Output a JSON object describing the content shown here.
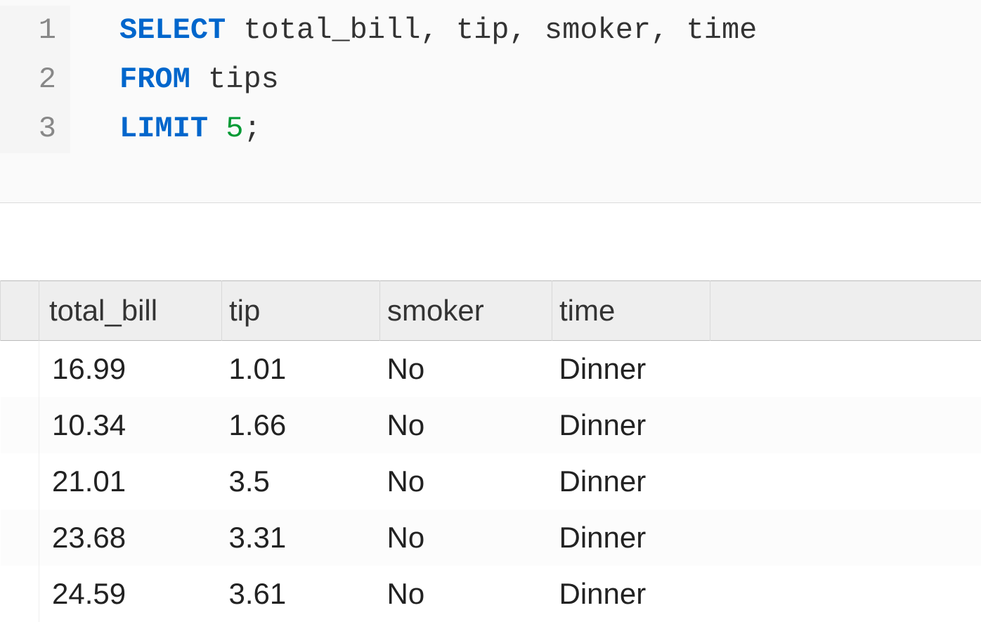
{
  "editor": {
    "line_numbers": [
      "1",
      "2",
      "3"
    ],
    "tokens": [
      [
        {
          "t": "SELECT",
          "c": "kw"
        },
        {
          "t": " total_bill, tip, smoker, time",
          "c": ""
        }
      ],
      [
        {
          "t": "FROM",
          "c": "kw"
        },
        {
          "t": " tips",
          "c": ""
        }
      ],
      [
        {
          "t": "LIMIT",
          "c": "kw"
        },
        {
          "t": " ",
          "c": ""
        },
        {
          "t": "5",
          "c": "num"
        },
        {
          "t": ";",
          "c": ""
        }
      ]
    ]
  },
  "results": {
    "columns": [
      "total_bill",
      "tip",
      "smoker",
      "time"
    ],
    "rows": [
      [
        "16.99",
        "1.01",
        "No",
        "Dinner"
      ],
      [
        "10.34",
        "1.66",
        "No",
        "Dinner"
      ],
      [
        "21.01",
        "3.5",
        "No",
        "Dinner"
      ],
      [
        "23.68",
        "3.31",
        "No",
        "Dinner"
      ],
      [
        "24.59",
        "3.61",
        "No",
        "Dinner"
      ]
    ]
  },
  "chart_data": {
    "type": "table",
    "columns": [
      "total_bill",
      "tip",
      "smoker",
      "time"
    ],
    "rows": [
      [
        16.99,
        1.01,
        "No",
        "Dinner"
      ],
      [
        10.34,
        1.66,
        "No",
        "Dinner"
      ],
      [
        21.01,
        3.5,
        "No",
        "Dinner"
      ],
      [
        23.68,
        3.31,
        "No",
        "Dinner"
      ],
      [
        24.59,
        3.61,
        "No",
        "Dinner"
      ]
    ]
  }
}
